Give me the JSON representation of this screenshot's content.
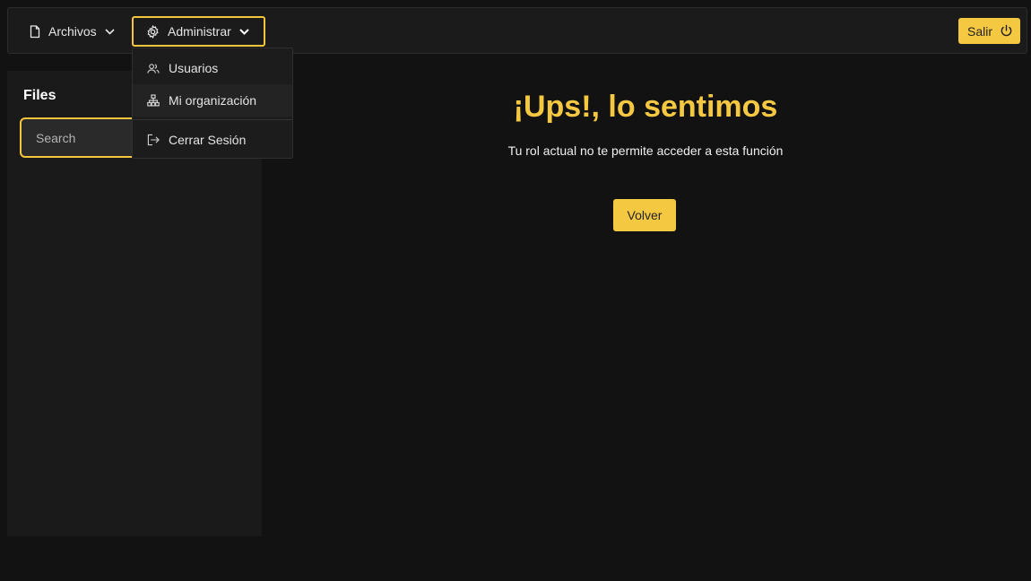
{
  "nav": {
    "files_label": "Archivos",
    "admin_label": "Administrar",
    "logout_label": "Salir"
  },
  "dropdown": {
    "items": [
      {
        "label": "Usuarios",
        "icon": "users-icon"
      },
      {
        "label": "Mi organización",
        "icon": "sitemap-icon"
      },
      {
        "label": "Cerrar Sesión",
        "icon": "sign-out-icon"
      }
    ]
  },
  "sidebar": {
    "title": "Files",
    "search_placeholder": "Search"
  },
  "main": {
    "title": "¡Ups!, lo sentimos",
    "message": "Tu rol actual no te permite acceder a esta función",
    "back_label": "Volver"
  },
  "colors": {
    "accent": "#f5c842",
    "background": "#121212",
    "panel": "#1a1a1a"
  }
}
